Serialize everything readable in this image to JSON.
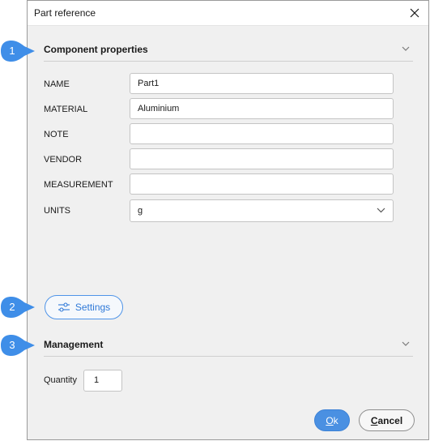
{
  "window": {
    "title": "Part reference"
  },
  "component": {
    "header": "Component properties",
    "fields": [
      {
        "label": "NAME",
        "value": "Part1"
      },
      {
        "label": "MATERIAL",
        "value": "Aluminium"
      },
      {
        "label": "NOTE",
        "value": ""
      },
      {
        "label": "VENDOR",
        "value": ""
      },
      {
        "label": "MEASUREMENT",
        "value": ""
      },
      {
        "label": "UNITS",
        "value": "g"
      }
    ]
  },
  "settings_button": {
    "label": "Settings"
  },
  "management": {
    "header": "Management",
    "quantity_label": "Quantity",
    "quantity_value": "1"
  },
  "buttons": {
    "ok_accel": "O",
    "ok_rest": "k",
    "cancel_accel": "C",
    "cancel_rest": "ancel"
  },
  "callouts": [
    "1",
    "2",
    "3"
  ],
  "colors": {
    "accent": "#4a90e2",
    "callout": "#3f8ee8",
    "dialog_bg": "#f0f0f0"
  },
  "icons": {
    "close": "close-icon",
    "collapse": "chevron-down-icon",
    "settings": "sliders-icon"
  }
}
